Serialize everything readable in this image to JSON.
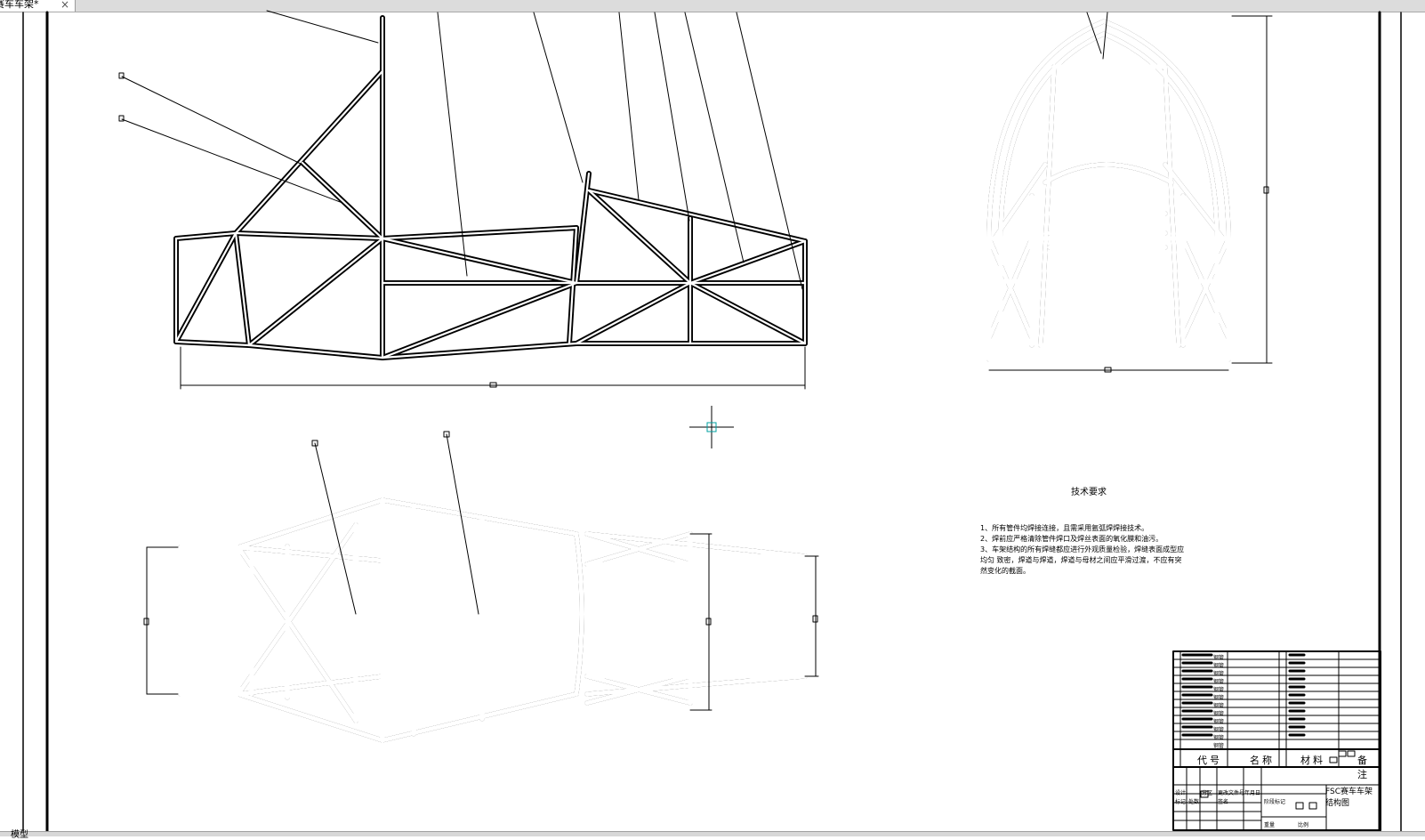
{
  "window": {
    "tab_title": "赛车车架*",
    "close_glyph": "×",
    "bottom_label": "模型"
  },
  "drawing": {
    "technical_requirements": {
      "title": "技术要求",
      "items": [
        "1、所有管件均焊接连接，且需采用氩弧焊焊接技术。",
        "2、焊前应严格清除管件焊口及焊丝表面的氧化膜和油污。",
        "3、车架结构的所有焊缝都应进行外观质量检验，焊缝表面成型应",
        "均匀  致密，焊道与焊道，焊道与母材之间应平滑过渡，不应有突",
        "然变化的截面。"
      ]
    },
    "title_block": {
      "header": {
        "code": "代号",
        "name": "名称",
        "material": "材料",
        "remark": "备注"
      },
      "drawing_name": "FSC赛车车架结构图",
      "parts_rows": [
        "钢管",
        "钢管",
        "钢管",
        "钢管",
        "钢管",
        "钢管",
        "钢管",
        "钢管",
        "钢管",
        "钢管",
        "钢管",
        "钢管"
      ],
      "small_labels": [
        "设计",
        "标记",
        "处数",
        "分区",
        "更改文件号",
        "签名",
        "年月日",
        "阶段标记",
        "重量",
        "比例"
      ]
    },
    "colors": {
      "line": "#000000",
      "cursor": "#00a0a0",
      "frame": "#000000"
    }
  }
}
